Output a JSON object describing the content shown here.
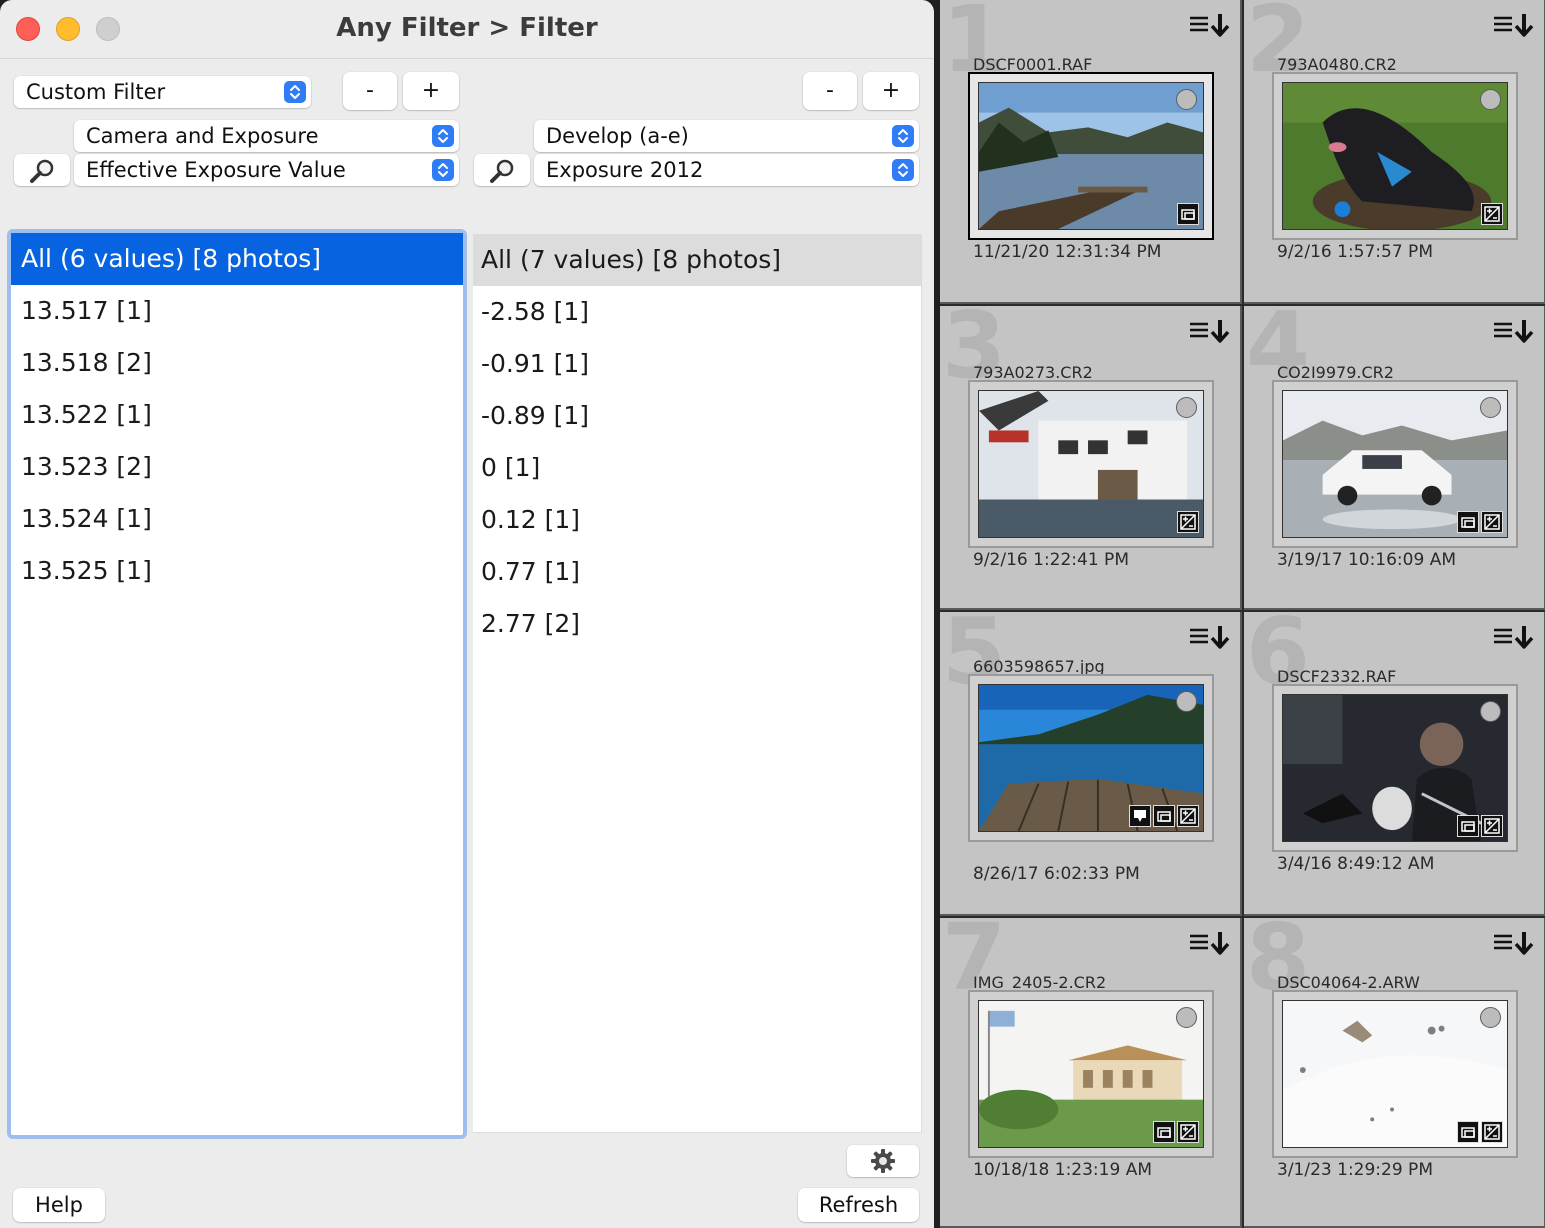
{
  "window": {
    "title": "Any Filter > Filter"
  },
  "toolbar": {
    "preset_select": "Custom Filter",
    "left_minus": "-",
    "left_plus": "+",
    "right_minus": "-",
    "right_plus": "+"
  },
  "left_column": {
    "category_select": "Camera and Exposure",
    "field_select": "Effective Exposure Value"
  },
  "right_column": {
    "category_select": "Develop (a-e)",
    "field_select": "Exposure 2012"
  },
  "left_list": {
    "header": "All (6 values) [8 photos]",
    "items": [
      "13.517 [1]",
      "13.518 [2]",
      "13.522 [1]",
      "13.523 [2]",
      "13.524 [1]",
      "13.525 [1]"
    ]
  },
  "right_list": {
    "header": "All (7 values) [8 photos]",
    "items": [
      "-2.58 [1]",
      "-0.91 [1]",
      "-0.89 [1]",
      "0 [1]",
      "0.12 [1]",
      "0.77 [1]",
      "2.77 [2]"
    ]
  },
  "footer": {
    "help": "Help",
    "refresh": "Refresh"
  },
  "grid": {
    "cells": [
      {
        "index": "1",
        "filename": "DSCF0001.RAF",
        "date": "11/21/20 12:31:34 PM"
      },
      {
        "index": "2",
        "filename": "793A0480.CR2",
        "date": "9/2/16 1:57:57 PM"
      },
      {
        "index": "3",
        "filename": "793A0273.CR2",
        "date": "9/2/16 1:22:41 PM"
      },
      {
        "index": "4",
        "filename": "CO2I9979.CR2",
        "date": "3/19/17 10:16:09 AM"
      },
      {
        "index": "5",
        "filename": "6603598657.jpg",
        "date": "8/26/17 6:02:33 PM"
      },
      {
        "index": "6",
        "filename": "DSCF2332.RAF",
        "date": "3/4/16 8:49:12 AM"
      },
      {
        "index": "7",
        "filename": "IMG_2405-2.CR2",
        "date": "10/18/18 1:23:19 AM"
      },
      {
        "index": "8",
        "filename": "DSC04064-2.ARW",
        "date": "3/1/23 1:29:29 PM"
      }
    ]
  },
  "colors": {
    "selection": "#0863e0",
    "focus_ring": "#9ebeef",
    "select_accent": "#2f7cf6"
  },
  "icons": [
    "magnifier-icon",
    "chevron-updown-icon",
    "gear-icon",
    "sort-menu-icon",
    "flag-circle-icon",
    "crop-badge-icon",
    "develop-badge-icon",
    "comment-badge-icon"
  ]
}
